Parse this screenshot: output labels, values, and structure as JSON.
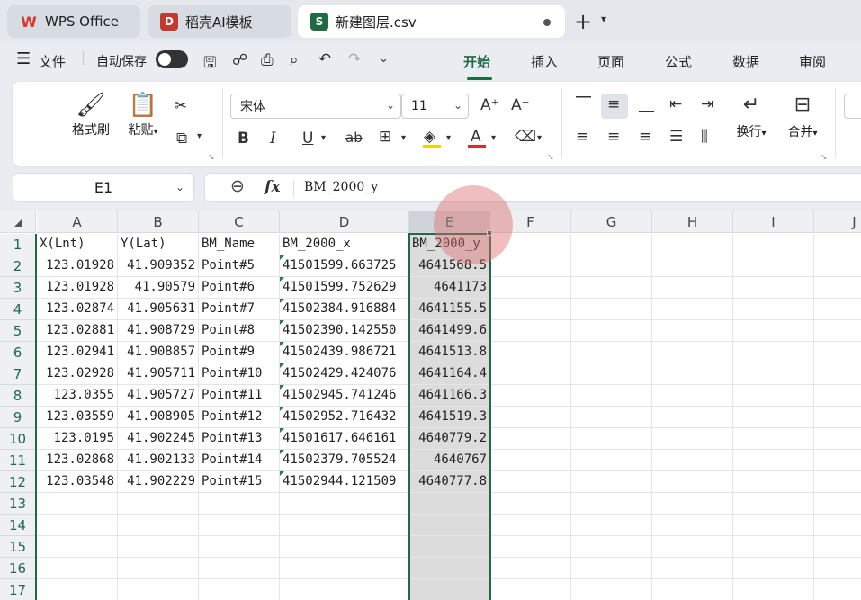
{
  "tabs": [
    {
      "label": "WPS Office",
      "icon": "wps-logo-icon",
      "color": "#d9372b"
    },
    {
      "label": "稻壳AI模板",
      "icon": "docer-logo-icon",
      "color": "#c23a2f"
    },
    {
      "label": "新建图层.csv",
      "icon": "spreadsheet-s-icon",
      "color": "#1d6a43",
      "active": true
    }
  ],
  "menubar": {
    "file_label": "文件",
    "autosave_label": "自动保存",
    "tabs": [
      "开始",
      "插入",
      "页面",
      "公式",
      "数据",
      "审阅"
    ],
    "active_tab": "开始"
  },
  "ribbon": {
    "format_painter": "格式刷",
    "paste": "粘贴",
    "font_name": "宋体",
    "font_size": "11",
    "wrap": "换行",
    "merge": "合并",
    "bold": "B",
    "italic": "I",
    "underline": "U",
    "strike": "ab"
  },
  "namebox": {
    "value": "E1"
  },
  "formula": {
    "content": "BM_2000_y"
  },
  "columns": [
    "A",
    "B",
    "C",
    "D",
    "E",
    "F",
    "G",
    "H",
    "I",
    "J"
  ],
  "rows": [
    "1",
    "2",
    "3",
    "4",
    "5",
    "6",
    "7",
    "8",
    "9",
    "10",
    "11",
    "12",
    "13",
    "14",
    "15",
    "16",
    "17"
  ],
  "selected_column": "E",
  "table": [
    [
      "X(Lnt)",
      "Y(Lat)",
      "BM_Name",
      "BM_2000_x",
      "BM_2000_y"
    ],
    [
      "123.01928",
      "41.909352",
      "Point#5",
      "41501599.663725",
      "4641568.5"
    ],
    [
      "123.01928",
      "41.90579",
      "Point#6",
      "41501599.752629",
      "4641173"
    ],
    [
      "123.02874",
      "41.905631",
      "Point#7",
      "41502384.916884",
      "4641155.5"
    ],
    [
      "123.02881",
      "41.908729",
      "Point#8",
      "41502390.142550",
      "4641499.6"
    ],
    [
      "123.02941",
      "41.908857",
      "Point#9",
      "41502439.986721",
      "4641513.8"
    ],
    [
      "123.02928",
      "41.905711",
      "Point#10",
      "41502429.424076",
      "4641164.4"
    ],
    [
      "123.0355",
      "41.905727",
      "Point#11",
      "41502945.741246",
      "4641166.3"
    ],
    [
      "123.03559",
      "41.908905",
      "Point#12",
      "41502952.716432",
      "4641519.3"
    ],
    [
      "123.0195",
      "41.902245",
      "Point#13",
      "41501617.646161",
      "4640779.2"
    ],
    [
      "123.02868",
      "41.902133",
      "Point#14",
      "41502379.705524",
      "4640767"
    ],
    [
      "123.03548",
      "41.902229",
      "Point#15",
      "41502944.121509",
      "4640777.8"
    ]
  ],
  "colors": {
    "accent": "#1d6a43",
    "selection": "#dcdcdc"
  }
}
